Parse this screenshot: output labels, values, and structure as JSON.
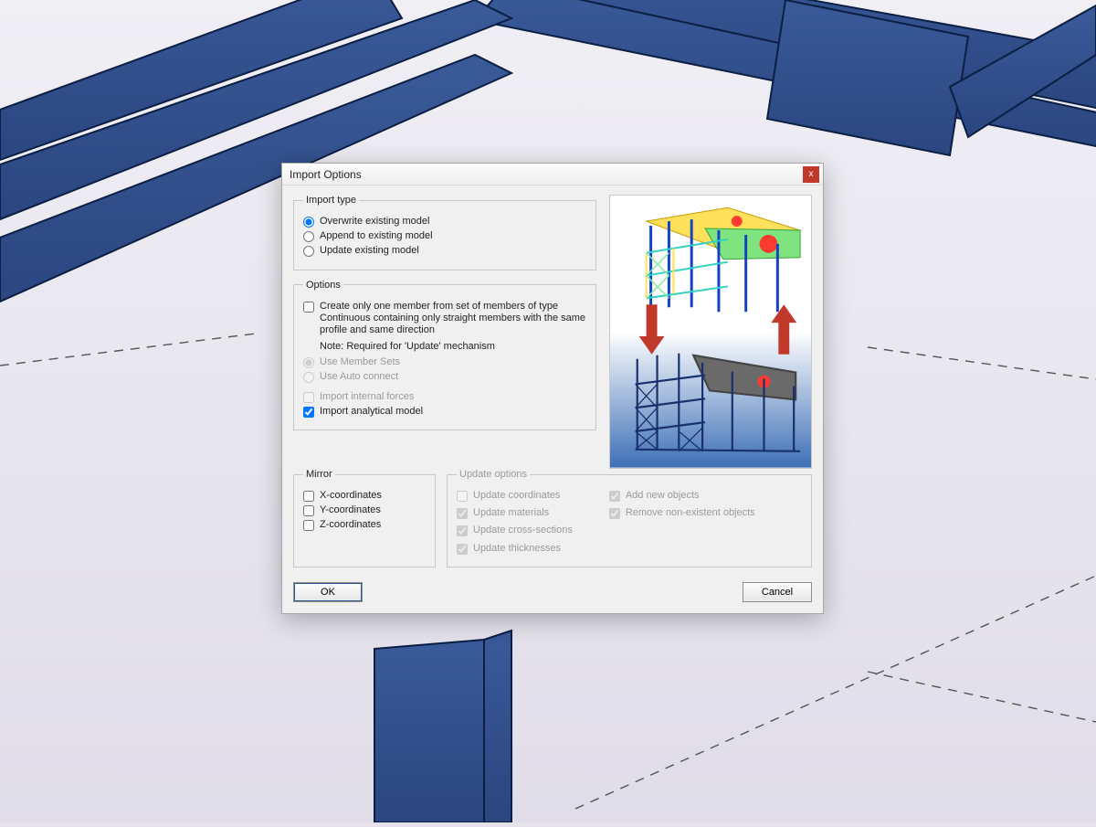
{
  "dialog": {
    "title": "Import Options",
    "close_glyph": "x",
    "groups": {
      "import_type": {
        "legend": "Import type",
        "options": {
          "overwrite": "Overwrite existing model",
          "append": "Append to existing model",
          "update": "Update existing model"
        },
        "selected": "overwrite"
      },
      "options": {
        "legend": "Options",
        "create_one_member": "Create only one member from set of members of type Continuous containing only straight members with the same profile and same direction",
        "note": "Note: Required for 'Update' mechanism",
        "use_member_sets": "Use Member Sets",
        "use_auto_connect": "Use Auto connect",
        "import_internal_forces": "Import internal forces",
        "import_analytical_model": "Import analytical model",
        "states": {
          "create_one_member": false,
          "use_member_sets": true,
          "use_auto_connect": false,
          "import_internal_forces": false,
          "import_analytical_model": true
        }
      },
      "mirror": {
        "legend": "Mirror",
        "x": "X-coordinates",
        "y": "Y-coordinates",
        "z": "Z-coordinates",
        "states": {
          "x": false,
          "y": false,
          "z": false
        }
      },
      "update_options": {
        "legend": "Update options",
        "update_coordinates": "Update coordinates",
        "update_materials": "Update materials",
        "update_cross_sections": "Update cross-sections",
        "update_thicknesses": "Update thicknesses",
        "add_new_objects": "Add new objects",
        "remove_nonexistent": "Remove non-existent objects",
        "states": {
          "update_coordinates": false,
          "update_materials": true,
          "update_cross_sections": true,
          "update_thicknesses": true,
          "add_new_objects": true,
          "remove_nonexistent": true
        }
      }
    },
    "buttons": {
      "ok": "OK",
      "cancel": "Cancel"
    }
  },
  "preview": {
    "arrow_color": "#c0392b",
    "top_model": "fea-colored-building",
    "bottom_model": "wireframe-building-on-gradient"
  }
}
